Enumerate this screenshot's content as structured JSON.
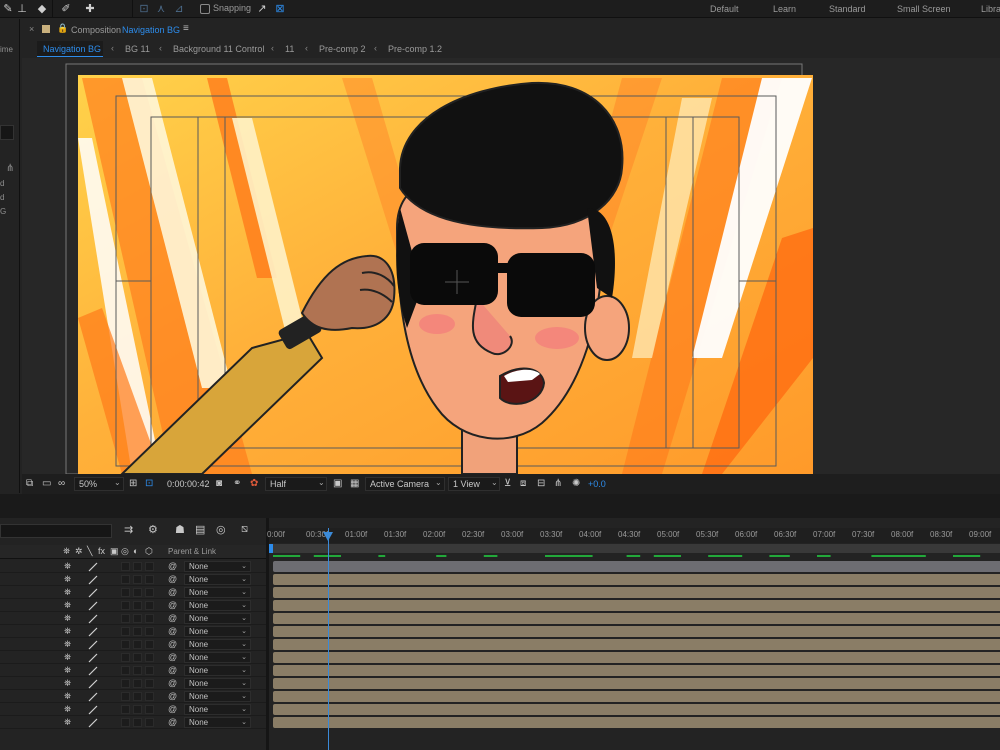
{
  "toolbar": {
    "snapping_label": "Snapping",
    "workspaces": [
      "Default",
      "Learn",
      "Standard",
      "Small Screen",
      "Libra"
    ]
  },
  "left_panel": {
    "fragments": [
      "ime",
      "d",
      "d",
      "d",
      "G"
    ]
  },
  "composition": {
    "label": "Composition",
    "name": "Navigation BG",
    "breadcrumbs": [
      "Navigation BG",
      "BG 11",
      "Background 11 Control",
      "11",
      "Pre-comp 2",
      "Pre-comp 1.2"
    ]
  },
  "viewer_bar": {
    "zoom": "50%",
    "timecode": "0:00:00:42",
    "resolution": "Half",
    "camera": "Active Camera",
    "views": "1 View",
    "exposure": "+0.0"
  },
  "timeline": {
    "parent_link_header": "Parent & Link",
    "ruler_labels": [
      "0:00f",
      "00:30f",
      "01:00f",
      "01:30f",
      "02:00f",
      "02:30f",
      "03:00f",
      "03:30f",
      "04:00f",
      "04:30f",
      "05:00f",
      "05:30f",
      "06:00f",
      "06:30f",
      "07:00f",
      "07:30f",
      "08:00f",
      "08:30f",
      "09:00f"
    ],
    "playhead_time_seconds": 0.7,
    "layers": [
      {
        "parent": "None"
      },
      {
        "parent": "None"
      },
      {
        "parent": "None"
      },
      {
        "parent": "None"
      },
      {
        "parent": "None"
      },
      {
        "parent": "None"
      },
      {
        "parent": "None"
      },
      {
        "parent": "None"
      },
      {
        "parent": "None"
      },
      {
        "parent": "None"
      },
      {
        "parent": "None"
      },
      {
        "parent": "None"
      },
      {
        "parent": "None"
      }
    ]
  },
  "colors": {
    "accent_blue": "#2d8ceb",
    "track_first": "#6d6d72",
    "track": "#8a7d66",
    "cache_green": "#22a83a"
  }
}
